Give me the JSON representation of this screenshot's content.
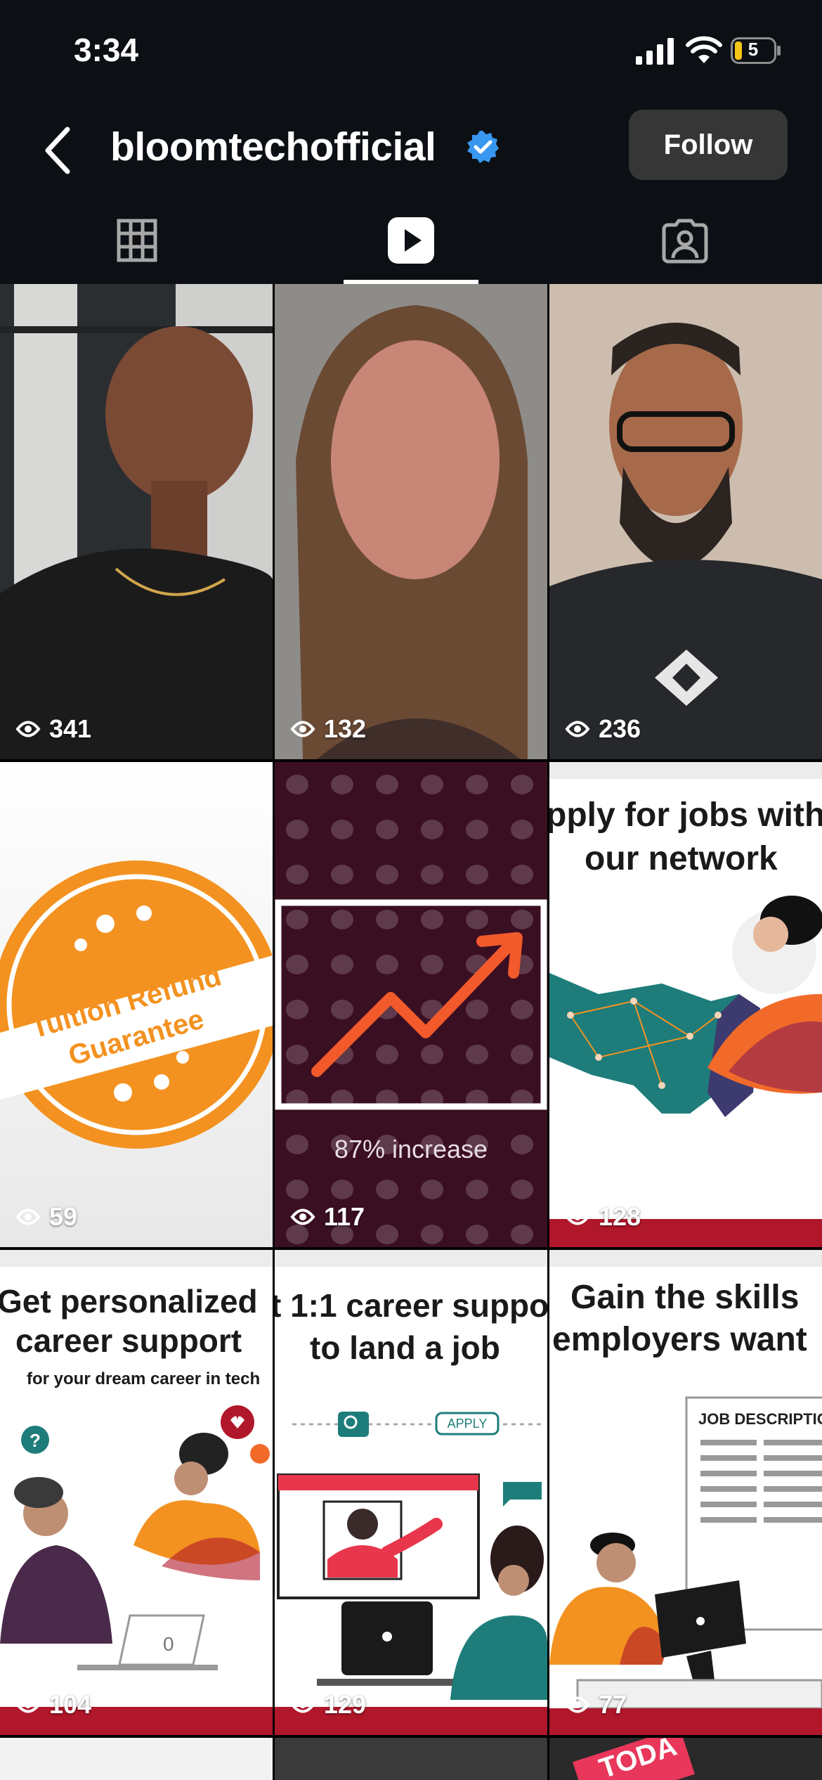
{
  "status_bar": {
    "time": "3:34",
    "battery": "5"
  },
  "header": {
    "username": "bloomtechofficial",
    "follow_label": "Follow"
  },
  "tabs": [
    {
      "name": "grid",
      "icon": "grid-icon",
      "active": false
    },
    {
      "name": "reels",
      "icon": "reels-icon",
      "active": true
    },
    {
      "name": "tagged",
      "icon": "tagged-icon",
      "active": false
    }
  ],
  "reels": [
    {
      "views": "341"
    },
    {
      "views": "132"
    },
    {
      "views": "236"
    },
    {
      "views": "59",
      "badge_text": [
        "Tuition Refund",
        "Guarantee"
      ]
    },
    {
      "views": "117",
      "caption": "87% increase"
    },
    {
      "views": "128",
      "title": [
        "pply for jobs with",
        "our network"
      ]
    },
    {
      "views": "104",
      "title": [
        "Get personalized",
        "career support"
      ],
      "subtitle": "for your dream career in tech"
    },
    {
      "views": "129",
      "title": [
        "t 1:1 career suppo",
        "to land a job"
      ],
      "apply_label": "APPLY"
    },
    {
      "views": "77",
      "title": [
        "Gain the skills",
        "employers want"
      ],
      "doc_label": "JOB DESCRIPTIO"
    },
    {
      "partial_text": "TODA"
    }
  ],
  "colors": {
    "verified": "#3897f0",
    "orange": "#f39220",
    "red": "#b0172a",
    "teal": "#1e7d7a"
  }
}
